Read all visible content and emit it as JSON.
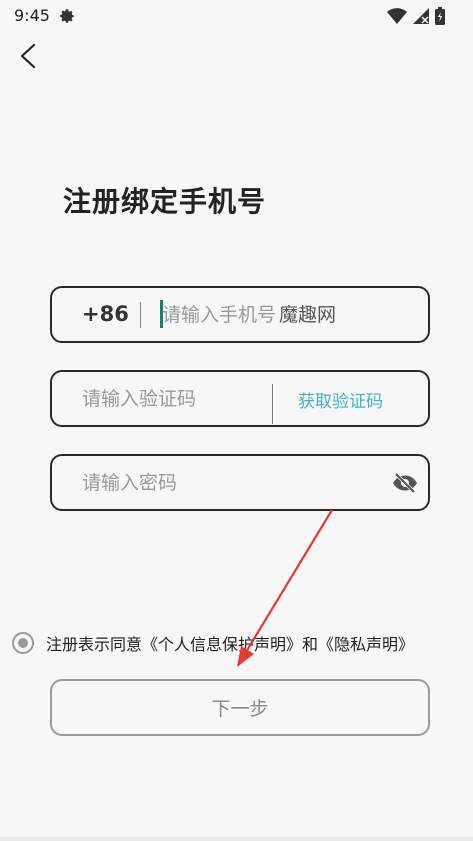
{
  "status_bar": {
    "time": "9:45"
  },
  "page": {
    "title": "注册绑定手机号"
  },
  "phone": {
    "country_code": "+86",
    "placeholder": "请输入手机号",
    "watermark": "魔趣网"
  },
  "code": {
    "placeholder": "请输入验证码",
    "get_code_label": "获取验证码"
  },
  "password": {
    "placeholder": "请输入密码"
  },
  "agreement": {
    "prefix": "注册表示同意",
    "privacy_info_link": "《个人信息保护声明》",
    "joiner": "和",
    "privacy_link": "《隐私声明》"
  },
  "next_button": {
    "label": "下一步"
  },
  "colors": {
    "accent": "#3fb3c9",
    "caret": "#1a7f6e",
    "arrow": "#e53935"
  },
  "icons": [
    "gear-icon",
    "wifi-icon",
    "signal-icon",
    "battery-icon",
    "back-arrow-icon",
    "eye-off-icon",
    "radio-icon"
  ]
}
